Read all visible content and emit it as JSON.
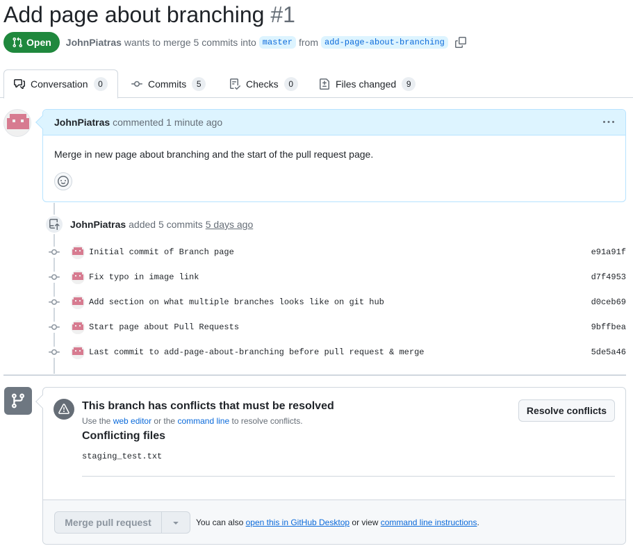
{
  "pr": {
    "title": "Add page about branching",
    "number": "#1",
    "state": "Open",
    "author": "JohnPiatras",
    "merge_text": "wants to merge 5 commits into",
    "base_branch": "master",
    "from_text": "from",
    "head_branch": "add-page-about-branching"
  },
  "tabs": [
    {
      "label": "Conversation",
      "count": "0"
    },
    {
      "label": "Commits",
      "count": "5"
    },
    {
      "label": "Checks",
      "count": "0"
    },
    {
      "label": "Files changed",
      "count": "9"
    }
  ],
  "comment": {
    "author": "JohnPiatras",
    "action": "commented 1 minute ago",
    "body": "Merge in new page about branching and the start of the pull request page."
  },
  "commits_event": {
    "author": "JohnPiatras",
    "action": "added 5 commits",
    "ago": "5 days ago"
  },
  "commits": [
    {
      "message": "Initial commit of Branch page",
      "sha": "e91a91f"
    },
    {
      "message": "Fix typo in image link",
      "sha": "d7f4953"
    },
    {
      "message": "Add section on what multiple branches looks like on git hub",
      "sha": "d0ceb69"
    },
    {
      "message": "Start page about Pull Requests",
      "sha": "9bffbea"
    },
    {
      "message": "Last commit to add-page-about-branching before pull request & merge",
      "sha": "5de5a46"
    }
  ],
  "mergebox": {
    "conflict_title": "This branch has conflicts that must be resolved",
    "conflict_sub_prefix": "Use the",
    "web_editor_link": "web editor",
    "conflict_sub_middle": "or the",
    "command_line_link": "command line",
    "conflict_sub_suffix": "to resolve conflicts.",
    "resolve_button": "Resolve conflicts",
    "conflicting_title": "Conflicting files",
    "conflicting_file": "staging_test.txt",
    "merge_button": "Merge pull request",
    "footer_prefix": "You can also",
    "desktop_link": "open this in GitHub Desktop",
    "footer_middle": "or view",
    "cli_link": "command line instructions",
    "footer_suffix": "."
  },
  "colors": {
    "open_green": "#1f883d",
    "link_blue": "#0969da",
    "comment_header": "#ddf4ff",
    "avatar_pink": "#d77b90"
  }
}
